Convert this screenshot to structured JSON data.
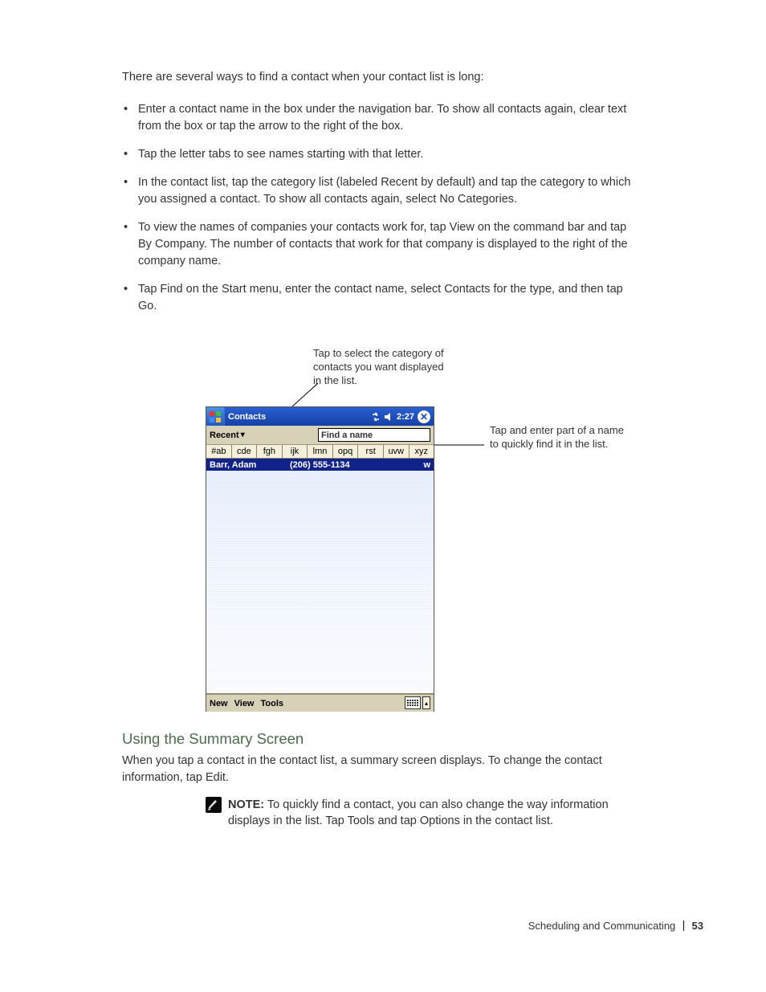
{
  "intro": "There are several ways to find a contact when your contact list is long:",
  "bullets": [
    "Enter a contact name in the box under the navigation bar. To show all contacts again, clear text from the box or tap the arrow to the right of the box.",
    "Tap the letter tabs to see names starting with that letter.",
    "In the contact list, tap the category list (labeled Recent by default) and tap the category to which you assigned a contact. To show all contacts again, select No Categories.",
    "To view the names of companies your contacts work for, tap View on the command bar and tap By Company. The number of contacts that work for that company is displayed to the right of the company name.",
    "Tap Find on the Start menu, enter the contact name, select Contacts for the type, and then tap Go."
  ],
  "callouts": {
    "left": "Tap to select the category of contacts you want displayed in the list.",
    "right": "Tap and enter part of a name to quickly find it in the list."
  },
  "device": {
    "title": "Contacts",
    "clock": "2:27",
    "toolbar": {
      "recent": "Recent"
    },
    "search_placeholder": "Find a name",
    "alpha": [
      "#ab",
      "cde",
      "fgh",
      "ijk",
      "lmn",
      "opq",
      "rst",
      "uvw",
      "xyz"
    ],
    "row": {
      "name": "Barr, Adam",
      "phone": "(206) 555-1134",
      "kind": "w"
    },
    "menu": {
      "new": "New",
      "view": "View",
      "tools": "Tools"
    }
  },
  "heading": "Using the Summary Screen",
  "summary_para": "When you tap a contact in the contact list, a summary screen displays. To change the contact information, tap Edit.",
  "note_label": "NOTE:",
  "note_body": "To quickly find a contact, you can also change the way information displays in the list. Tap Tools and tap Options in the contact list.",
  "footer": {
    "text": "Scheduling and Communicating",
    "page": "53"
  }
}
